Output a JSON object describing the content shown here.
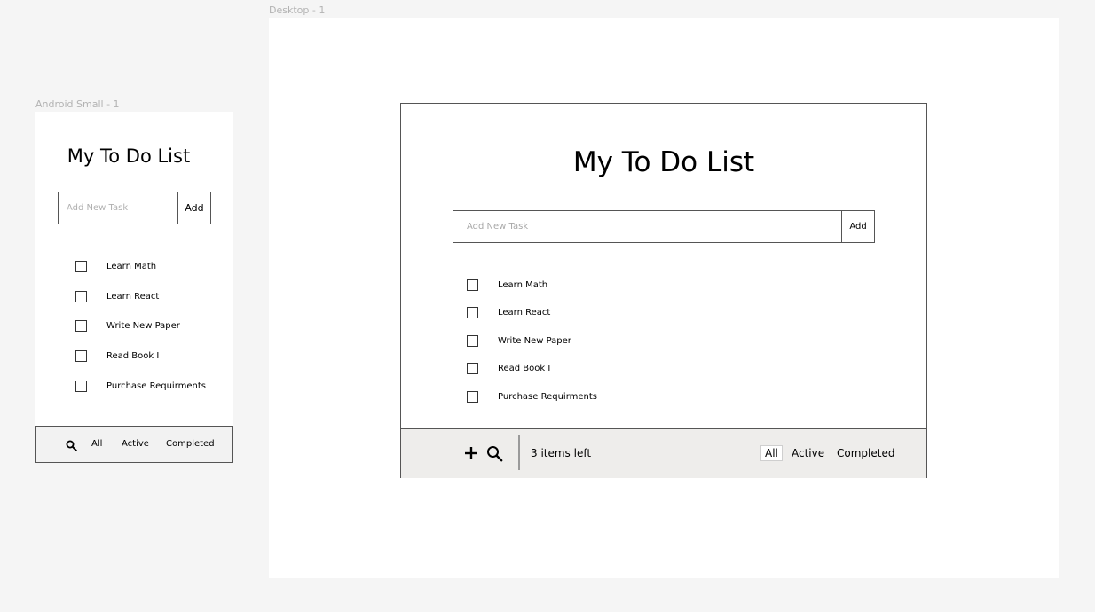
{
  "frames": {
    "android_label": "Android Small - 1",
    "desktop_label": "Desktop - 1"
  },
  "mobile": {
    "title": "My To Do List",
    "add_placeholder": "Add New Task",
    "add_label": "Add",
    "tasks": [
      {
        "label": "Learn Math",
        "done": false
      },
      {
        "label": "Learn React",
        "done": false
      },
      {
        "label": "Write New Paper",
        "done": false
      },
      {
        "label": "Read Book I",
        "done": false
      },
      {
        "label": "Purchase Requirments",
        "done": false
      }
    ],
    "footer": {
      "search_icon": "search-icon",
      "filters": [
        "All",
        "Active",
        "Completed"
      ]
    }
  },
  "desktop": {
    "title": "My To Do List",
    "add_placeholder": "Add New Task",
    "add_label": "Add",
    "tasks": [
      {
        "label": "Learn Math",
        "done": false
      },
      {
        "label": "Learn React",
        "done": false
      },
      {
        "label": "Write New Paper",
        "done": false
      },
      {
        "label": "Read Book I",
        "done": false
      },
      {
        "label": "Purchase Requirments",
        "done": false
      }
    ],
    "footer": {
      "add_icon": "plus-icon",
      "search_icon": "search-icon",
      "items_left": "3 items left",
      "filters": [
        "All",
        "Active",
        "Completed"
      ],
      "selected_filter": "All"
    }
  },
  "colors": {
    "canvas": "#f5f5f5",
    "frame": "#ffffff",
    "border": "#555555",
    "footer_bg": "#eeedeb",
    "placeholder": "#a8a8a8"
  }
}
